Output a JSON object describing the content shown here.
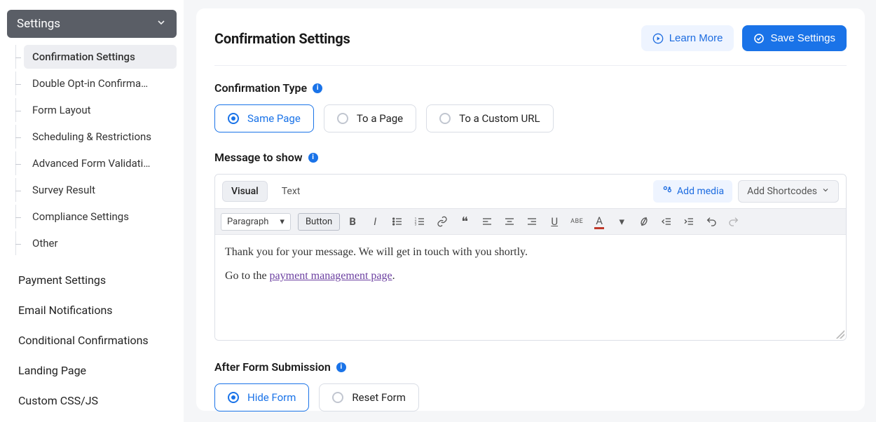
{
  "sidebar": {
    "header": "Settings",
    "sub_items": [
      {
        "label": "Confirmation Settings",
        "active": true
      },
      {
        "label": "Double Opt-in Confirma…",
        "active": false
      },
      {
        "label": "Form Layout",
        "active": false
      },
      {
        "label": "Scheduling & Restrictions",
        "active": false
      },
      {
        "label": "Advanced Form Validati…",
        "active": false
      },
      {
        "label": "Survey Result",
        "active": false
      },
      {
        "label": "Compliance Settings",
        "active": false
      },
      {
        "label": "Other",
        "active": false
      }
    ],
    "top_items": [
      "Payment Settings",
      "Email Notifications",
      "Conditional Confirmations",
      "Landing Page",
      "Custom CSS/JS"
    ]
  },
  "header": {
    "title": "Confirmation Settings",
    "learn_more": "Learn More",
    "save": "Save Settings"
  },
  "confirmation_type": {
    "label": "Confirmation Type",
    "options": [
      "Same Page",
      "To a Page",
      "To a Custom URL"
    ],
    "selected_index": 0
  },
  "message": {
    "label": "Message to show",
    "tabs": {
      "visual": "Visual",
      "text": "Text"
    },
    "add_media": "Add media",
    "add_shortcodes": "Add Shortcodes",
    "format_select": "Paragraph",
    "button_chip": "Button",
    "body_line1": "Thank you for your message. We will get in touch with you shortly.",
    "body_line2_prefix": "Go to the ",
    "body_line2_link": "payment management page",
    "body_line2_suffix": "."
  },
  "after_submission": {
    "label": "After Form Submission",
    "options": [
      "Hide Form",
      "Reset Form"
    ],
    "selected_index": 0
  }
}
